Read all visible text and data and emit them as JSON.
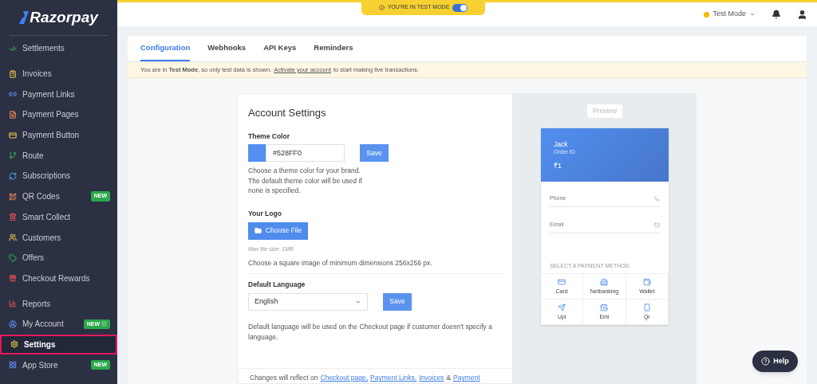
{
  "sidebar": {
    "logo": "Razorpay",
    "sections": [
      {
        "items": [
          {
            "label": "Settlements",
            "selected": false
          }
        ]
      },
      {
        "items": [
          {
            "label": "Invoices",
            "selected": false
          },
          {
            "label": "Payment Links",
            "selected": false
          },
          {
            "label": "Payment Pages",
            "selected": false
          },
          {
            "label": "Payment Button",
            "selected": false
          },
          {
            "label": "Route",
            "selected": false
          },
          {
            "label": "Subscriptions",
            "selected": false
          },
          {
            "label": "QR Codes",
            "selected": false,
            "badge": "NEW"
          },
          {
            "label": "Smart Collect",
            "selected": false
          },
          {
            "label": "Customers",
            "selected": false
          },
          {
            "label": "Offers",
            "selected": false
          },
          {
            "label": "Checkout Rewards",
            "selected": false
          }
        ]
      },
      {
        "items": [
          {
            "label": "Reports",
            "selected": false
          },
          {
            "label": "My Account",
            "selected": false,
            "badge": "NEW",
            "badge_shield": true
          },
          {
            "label": "Settings",
            "selected": true
          },
          {
            "label": "App Store",
            "selected": false,
            "badge": "NEW"
          }
        ]
      }
    ]
  },
  "top_bar": {
    "test_mode_banner": {
      "label": "YOU'RE IN TEST MODE",
      "on": true
    },
    "mode_menu": "Test Mode"
  },
  "tabs": [
    {
      "label": "Configuration",
      "selected": true
    },
    {
      "label": "Webhooks",
      "selected": false
    },
    {
      "label": "API Keys",
      "selected": false
    },
    {
      "label": "Reminders",
      "selected": false
    }
  ],
  "notice": {
    "text": "You are in **Test Mode**, so only test data is shown.",
    "link": "Activate your account",
    "after": "to start making live transactions."
  },
  "account_settings": {
    "title": "Account Settings",
    "theme_color": {
      "label": "Theme Color",
      "color": "#528ff0",
      "value": "#528FF0",
      "button": "Save",
      "help": [
        "Choose a theme color for your brand.",
        "The default theme color will be used if",
        "none is specified."
      ]
    },
    "logo": {
      "label": "Your Logo",
      "button": "Choose File",
      "note": "Max file size: 1MB",
      "help": "Choose a square image of minimum dimensions 256x256 px."
    },
    "language": {
      "label": "Default Language",
      "value": "English",
      "button": "Save",
      "help": "Default language will be used on the Checkout page if customer doesn't specify a language."
    },
    "footer": {
      "text": "Changes will reflect on",
      "links": [
        "Checkout page,",
        "Payment Links,",
        "Invoices"
      ],
      "joiner": "&",
      "last_link": "Payment"
    }
  },
  "preview": {
    "label": "Preview",
    "name": "Jack",
    "order": "Order ID",
    "amount": "₹1",
    "fields": [
      "Phone",
      "Email"
    ],
    "methods_title": "SELECT A PAYMENT METHOD",
    "methods": [
      "Card",
      "Netbanking",
      "Wallet",
      "Upi",
      "Emi",
      "Qr"
    ]
  },
  "help_button": "Help"
}
